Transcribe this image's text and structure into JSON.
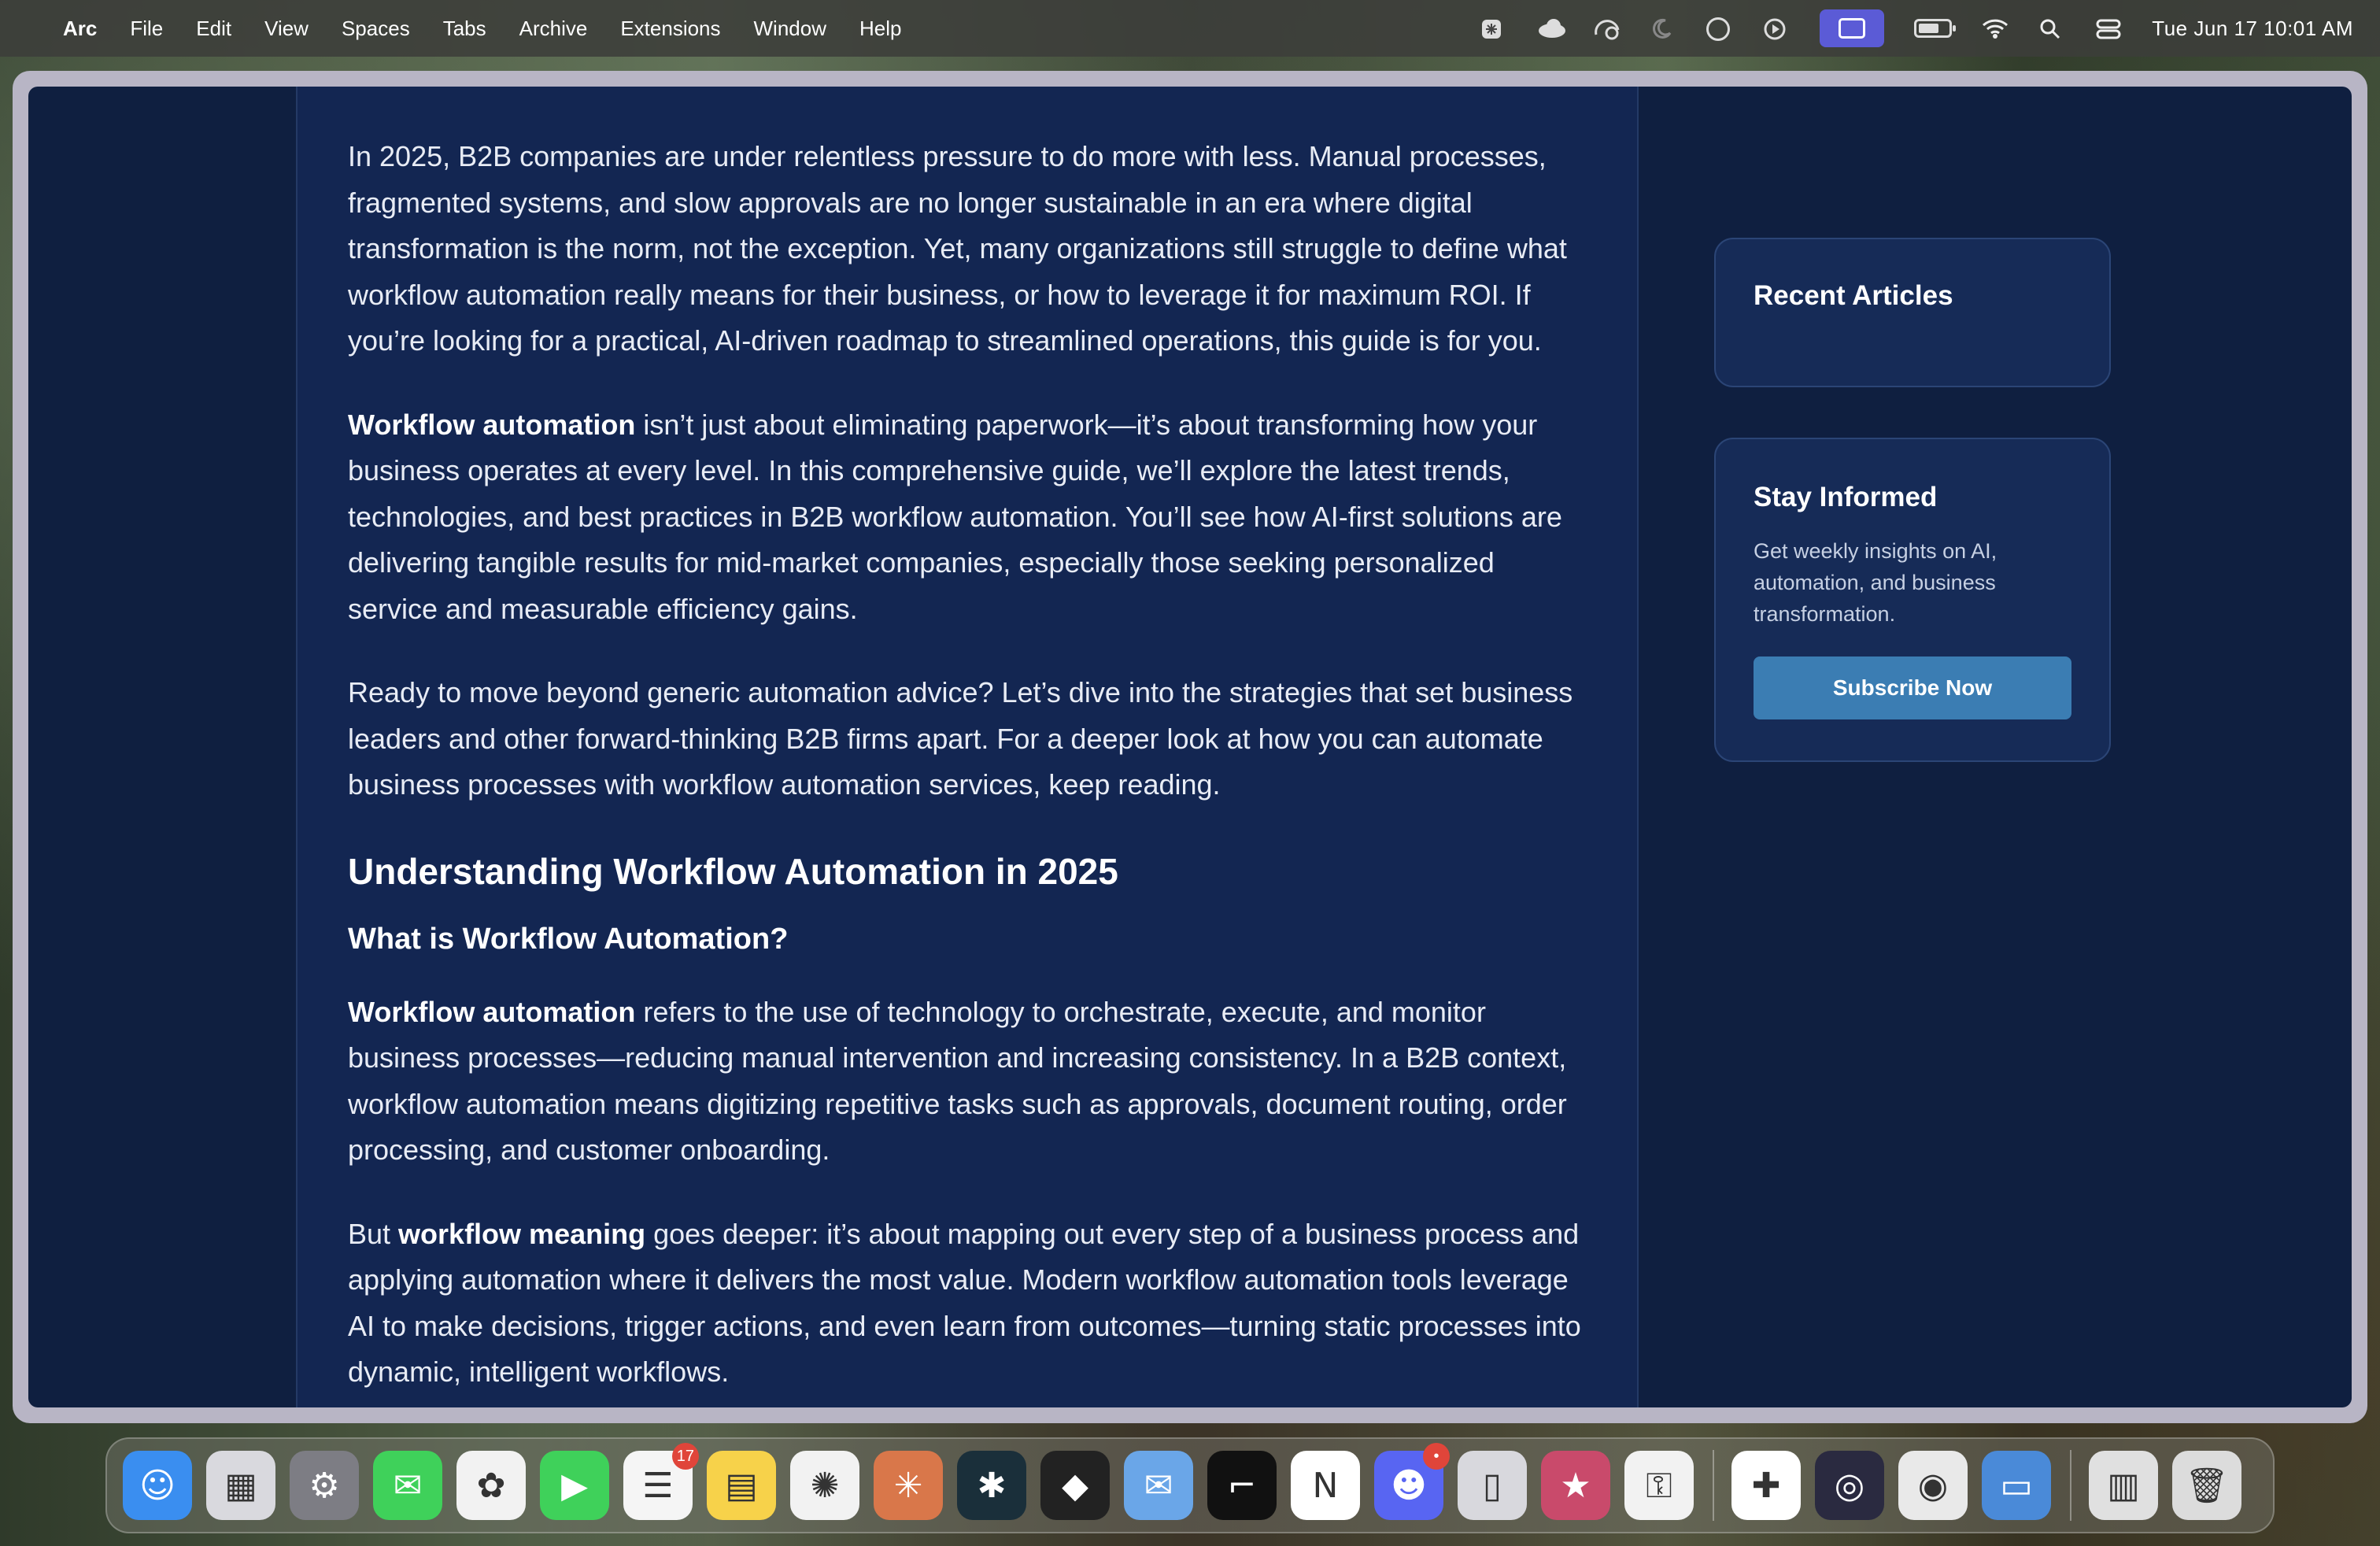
{
  "menubar": {
    "app_name": "Arc",
    "menus": [
      "File",
      "Edit",
      "View",
      "Spaces",
      "Tabs",
      "Archive",
      "Extensions",
      "Window",
      "Help"
    ],
    "status_icons": [
      "perplexity-icon",
      "cloud-icon",
      "sync-icon",
      "moon-icon",
      "grid-icon",
      "play-icon",
      "screen-mirror-icon",
      "battery-icon",
      "wifi-icon",
      "search-icon",
      "control-center-icon"
    ],
    "clock": "Tue Jun 17  10:01 AM"
  },
  "article": {
    "p1": "In 2025, B2B companies are under relentless pressure to do more with less. Manual processes, fragmented systems, and slow approvals are no longer sustainable in an era where digital transformation is the norm, not the exception. Yet, many organizations still struggle to define what workflow automation really means for their business, or how to leverage it for maximum ROI. If you’re looking for a practical, AI-driven roadmap to streamlined operations, this guide is for you.",
    "p2_bold": "Workflow automation",
    "p2_rest": " isn’t just about eliminating paperwork—it’s about transforming how your business operates at every level. In this comprehensive guide, we’ll explore the latest trends, technologies, and best practices in B2B workflow automation. You’ll see how AI-first solutions are delivering tangible results for mid-market companies, especially those seeking personalized service and measurable efficiency gains.",
    "p3": "Ready to move beyond generic automation advice? Let’s dive into the strategies that set business leaders and other forward-thinking B2B firms apart. For a deeper look at how you can automate business processes with workflow automation services, keep reading.",
    "h2": "Understanding Workflow Automation in 2025",
    "h3": "What is Workflow Automation?",
    "p4_bold": "Workflow automation",
    "p4_rest": " refers to the use of technology to orchestrate, execute, and monitor business processes—reducing manual intervention and increasing consistency. In a B2B context, workflow automation means digitizing repetitive tasks such as approvals, document routing, order processing, and customer onboarding.",
    "p5_pre": "But ",
    "p5_bold": "workflow meaning",
    "p5_rest": " goes deeper: it’s about mapping out every step of a business process and applying automation where it delivers the most value. Modern workflow automation tools leverage AI to make decisions, trigger actions, and even learn from outcomes—turning static processes into dynamic, intelligent workflows."
  },
  "sidebar": {
    "recent_title": "Recent Articles",
    "stay_title": "Stay Informed",
    "stay_text": "Get weekly insights on AI, automation, and business transformation.",
    "subscribe_label": "Subscribe Now"
  },
  "dock": {
    "reminders_badge": "17",
    "discord_badge": "•",
    "items": [
      {
        "name": "finder-icon",
        "glyph": "☺",
        "color": "#3a8ef0"
      },
      {
        "name": "launchpad-icon",
        "glyph": "▦",
        "color": "#d9d9de"
      },
      {
        "name": "system-settings-icon",
        "glyph": "⚙",
        "color": "#7d7d84"
      },
      {
        "name": "messages-icon",
        "glyph": "✉",
        "color": "#3fd15a"
      },
      {
        "name": "photos-icon",
        "glyph": "✿",
        "color": "#f2f2f2"
      },
      {
        "name": "facetime-icon",
        "glyph": "▶",
        "color": "#3fd15a"
      },
      {
        "name": "reminders-icon",
        "glyph": "☰",
        "color": "#f5f5f5"
      },
      {
        "name": "notes-icon",
        "glyph": "▤",
        "color": "#f7d24a"
      },
      {
        "name": "chatgpt-icon",
        "glyph": "✺",
        "color": "#f2f2f2"
      },
      {
        "name": "claude-icon",
        "glyph": "✳",
        "color": "#d9774a"
      },
      {
        "name": "perplexity-app-icon",
        "glyph": "✱",
        "color": "#1a2f3a"
      },
      {
        "name": "tasks-app-icon",
        "glyph": "◆",
        "color": "#222222"
      },
      {
        "name": "mail-app-icon",
        "glyph": "✉",
        "color": "#6aa6e8"
      },
      {
        "name": "screenshot-app-icon",
        "glyph": "⌐",
        "color": "#111111"
      },
      {
        "name": "notion-icon",
        "glyph": "N",
        "color": "#ffffff"
      },
      {
        "name": "discord-icon",
        "glyph": "☻",
        "color": "#5865f2"
      },
      {
        "name": "iphone-mirroring-icon",
        "glyph": "▯",
        "color": "#d8d8dd"
      },
      {
        "name": "creative-app-icon",
        "glyph": "★",
        "color": "#c94a6b"
      },
      {
        "name": "passwords-icon",
        "glyph": "⚿",
        "color": "#f2f2f2"
      },
      {
        "name": "slack-icon",
        "glyph": "✚",
        "color": "#ffffff"
      },
      {
        "name": "obs-icon",
        "glyph": "◎",
        "color": "#2a2a40"
      },
      {
        "name": "chrome-icon",
        "glyph": "◉",
        "color": "#e9e9e9"
      },
      {
        "name": "display-icon",
        "glyph": "▭",
        "color": "#4a8ad8"
      },
      {
        "name": "downloads-stack-icon",
        "glyph": "▥",
        "color": "#e0e0e0"
      },
      {
        "name": "trash-icon",
        "glyph": "🗑",
        "color": "#dcdcdc"
      }
    ]
  }
}
